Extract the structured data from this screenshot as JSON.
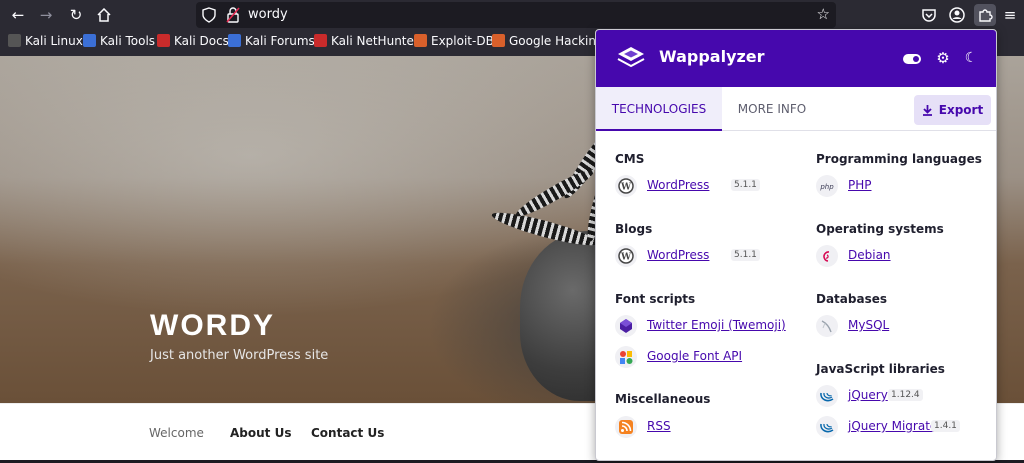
{
  "browser": {
    "url": "wordy",
    "bookmarks": [
      {
        "label": "Kali Linux",
        "color": "#2b2a33"
      },
      {
        "label": "Kali Tools",
        "color": "#3b6fd6"
      },
      {
        "label": "Kali Docs",
        "color": "#c92b2b"
      },
      {
        "label": "Kali Forums",
        "color": "#3b6fd6"
      },
      {
        "label": "Kali NetHunter",
        "color": "#c92b2b"
      },
      {
        "label": "Exploit-DB",
        "color": "#d9602b"
      },
      {
        "label": "Google Hacking D",
        "color": "#d9602b"
      }
    ]
  },
  "site": {
    "title": "WORDY",
    "description": "Just another WordPress site",
    "nav": [
      "Welcome",
      "About Us",
      "Contact Us"
    ]
  },
  "wappalyzer": {
    "brand": "Wappalyzer",
    "accent": "#4608ad",
    "tabs": {
      "technologies": "TECHNOLOGIES",
      "more_info": "MORE INFO"
    },
    "export_label": "Export",
    "left": [
      {
        "category": "CMS",
        "items": [
          {
            "name": "WordPress",
            "version": "5.1.1",
            "icon": "wordpress-icon"
          }
        ]
      },
      {
        "category": "Blogs",
        "items": [
          {
            "name": "WordPress",
            "version": "5.1.1",
            "icon": "wordpress-icon"
          }
        ]
      },
      {
        "category": "Font scripts",
        "items": [
          {
            "name": "Twitter Emoji (Twemoji)",
            "version": "",
            "icon": "twemoji-icon"
          },
          {
            "name": "Google Font API",
            "version": "",
            "icon": "google-font-icon"
          }
        ]
      },
      {
        "category": "Miscellaneous",
        "items": [
          {
            "name": "RSS",
            "version": "",
            "icon": "rss-icon"
          }
        ]
      }
    ],
    "right": [
      {
        "category": "Programming languages",
        "items": [
          {
            "name": "PHP",
            "version": "",
            "icon": "php-icon"
          }
        ]
      },
      {
        "category": "Operating systems",
        "items": [
          {
            "name": "Debian",
            "version": "",
            "icon": "debian-icon"
          }
        ]
      },
      {
        "category": "Databases",
        "items": [
          {
            "name": "MySQL",
            "version": "",
            "icon": "mysql-icon"
          }
        ]
      },
      {
        "category": "JavaScript libraries",
        "items": [
          {
            "name": "jQuery",
            "version": "1.12.4",
            "icon": "jquery-icon"
          },
          {
            "name": "jQuery Migrate",
            "version": "1.4.1",
            "icon": "jquery-icon"
          }
        ]
      }
    ]
  }
}
